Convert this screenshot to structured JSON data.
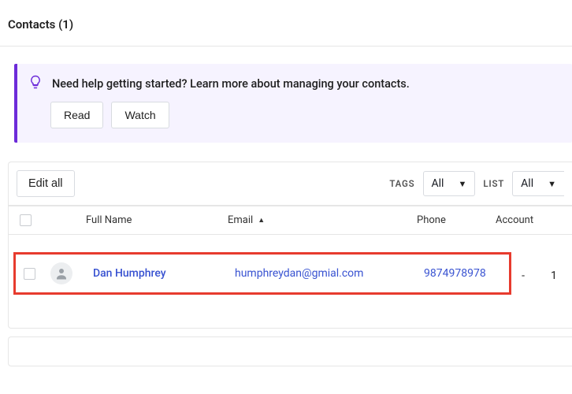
{
  "header": {
    "title": "Contacts (1)"
  },
  "banner": {
    "text": "Need help getting started? Learn more about managing your contacts.",
    "read_label": "Read",
    "watch_label": "Watch"
  },
  "toolbar": {
    "edit_all_label": "Edit all",
    "tags_label": "TAGS",
    "tags_value": "All",
    "list_label": "LIST",
    "list_value": "All"
  },
  "columns": {
    "full_name": "Full Name",
    "email": "Email",
    "phone": "Phone",
    "account": "Account"
  },
  "rows": [
    {
      "name": "Dan Humphrey",
      "email": "humphreydan@gmial.com",
      "phone": "9874978978",
      "account": "-",
      "trail": "1"
    }
  ]
}
